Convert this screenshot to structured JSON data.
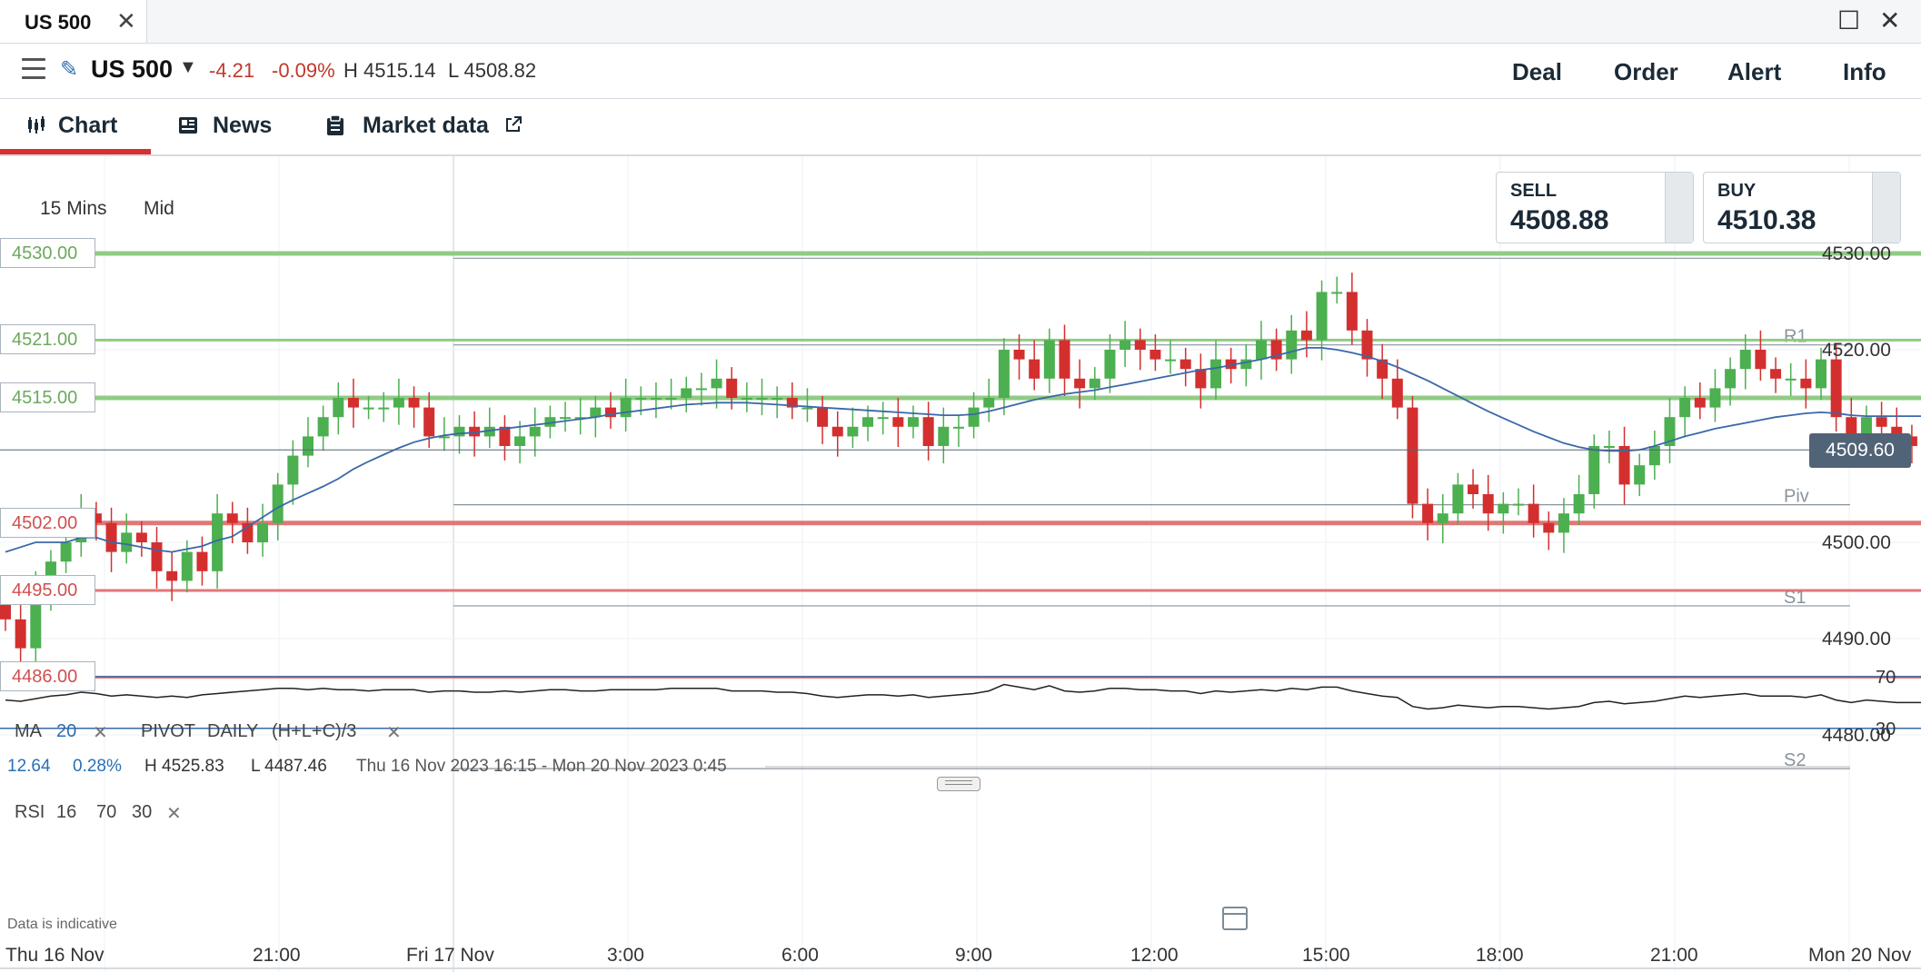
{
  "tab": {
    "title": "US 500",
    "close": "✕"
  },
  "window": {
    "maximize": "☐",
    "close": "✕"
  },
  "header": {
    "market": "US 500",
    "change": "-4.21",
    "change_pct": "-0.09%",
    "high": "H 4515.14",
    "low": "L 4508.82",
    "buttons": [
      "Deal",
      "Order",
      "Alert",
      "Info"
    ]
  },
  "subtabs": [
    {
      "label": "Chart",
      "active": true,
      "icon": "candlestick-icon"
    },
    {
      "label": "News",
      "active": false,
      "icon": "newspaper-icon"
    },
    {
      "label": "Market data",
      "active": false,
      "icon": "clipboard-icon"
    }
  ],
  "toolbar": {
    "timeframe": "15 Mins",
    "price_type": "Mid"
  },
  "quote": {
    "sell_label": "SELL",
    "sell": "4508.88",
    "buy_label": "BUY",
    "buy": "4510.38"
  },
  "indicators": {
    "ma_label": "MA",
    "ma_period": "20",
    "pivot_label": "PIVOT",
    "pivot_period": "DAILY",
    "pivot_formula": "(H+L+C)/3",
    "remove": "✕"
  },
  "stats": {
    "change": "12.64",
    "change_pct": "0.28%",
    "high": "H 4525.83",
    "low": "L 4487.46",
    "range": "Thu 16 Nov 2023 16:15 - Mon 20 Nov 2023 0:45"
  },
  "rsi": {
    "label": "RSI",
    "period": "16",
    "upper": "70",
    "lower": "30",
    "remove": "✕"
  },
  "disclaimer": "Data is indicative",
  "colors": {
    "up": "#4caf50",
    "down": "#d32f2f",
    "ma": "#3a68a8",
    "support": "#e07070",
    "resistance": "#8cc97f"
  },
  "chart_data": {
    "type": "candlestick",
    "y_axis": {
      "ticks": [
        4530,
        4520,
        4500,
        4490,
        4480
      ],
      "range": [
        4476,
        4535
      ]
    },
    "x_axis": {
      "ticks": [
        "Thu 16 Nov",
        "21:00",
        "Fri 17 Nov",
        "3:00",
        "6:00",
        "9:00",
        "12:00",
        "15:00",
        "18:00",
        "21:00",
        "Mon 20 Nov"
      ]
    },
    "current_price": "4509.60",
    "levels": [
      {
        "label": "4530.00",
        "value": 4530,
        "kind": "resistance"
      },
      {
        "label": "4521.00",
        "value": 4521,
        "kind": "resistance"
      },
      {
        "label": "4515.00",
        "value": 4515,
        "kind": "resistance"
      },
      {
        "label": "4502.00",
        "value": 4502,
        "kind": "support"
      },
      {
        "label": "4495.00",
        "value": 4495,
        "kind": "support"
      },
      {
        "label": "4486.00",
        "value": 4486,
        "kind": "support"
      }
    ],
    "pivots": [
      {
        "label": "",
        "value": 4529.5
      },
      {
        "label": "R1",
        "value": 4520.5
      },
      {
        "label": "Piv",
        "value": 4503.9
      },
      {
        "label": "S1",
        "value": 4493.4
      },
      {
        "label": "S2",
        "value": 4476.5
      }
    ],
    "close": [
      4492,
      4489,
      4495,
      4498,
      4500,
      4503,
      4502,
      4499,
      4501,
      4500,
      4497,
      4496,
      4499,
      4497,
      4503,
      4502,
      4500,
      4502,
      4506,
      4509,
      4511,
      4513,
      4515,
      4514,
      4514,
      4514,
      4515,
      4514,
      4511,
      4511,
      4512,
      4511,
      4512,
      4510,
      4511,
      4512,
      4513,
      4513,
      4513,
      4514,
      4513,
      4515,
      4515,
      4515,
      4515,
      4516,
      4516,
      4517,
      4515,
      4515,
      4515,
      4515,
      4514,
      4514,
      4512,
      4511,
      4512,
      4513,
      4513,
      4512,
      4513,
      4510,
      4512,
      4512,
      4514,
      4515,
      4520,
      4519,
      4517,
      4521,
      4517,
      4516,
      4517,
      4520,
      4521,
      4520,
      4519,
      4519,
      4518,
      4516,
      4519,
      4518,
      4519,
      4521,
      4519,
      4522,
      4521,
      4526,
      4526,
      4522,
      4519,
      4517,
      4514,
      4504,
      4502,
      4503,
      4506,
      4505,
      4503,
      4504,
      4504,
      4502,
      4501,
      4503,
      4505,
      4510,
      4510,
      4506,
      4508,
      4510,
      4513,
      4515,
      4514,
      4516,
      4518,
      4520,
      4518,
      4517,
      4517,
      4516,
      4519,
      4513,
      4511,
      4513,
      4512,
      4511,
      4510,
      4510
    ],
    "ma": [
      4499,
      4499.5,
      4500,
      4500,
      4500,
      4500.5,
      4500.5,
      4500,
      4499.8,
      4499.5,
      4499.2,
      4499,
      4499.3,
      4499.6,
      4500.2,
      4500.6,
      4501.6,
      4502.6,
      4503.6,
      4504.4,
      4505.1,
      4505.8,
      4506.6,
      4507.6,
      4508.4,
      4509.1,
      4509.8,
      4510.4,
      4510.8,
      4511.1,
      4511.3,
      4511.4,
      4511.6,
      4511.8,
      4512,
      4512.2,
      4512.4,
      4512.6,
      4512.8,
      4513,
      4513.3,
      4513.5,
      4513.7,
      4513.9,
      4514.1,
      4514.3,
      4514.4,
      4514.5,
      4514.5,
      4514.5,
      4514.4,
      4514.3,
      4514.2,
      4514.1,
      4514,
      4513.9,
      4513.8,
      4513.7,
      4513.6,
      4513.5,
      4513.4,
      4513.3,
      4513.2,
      4513.2,
      4513.3,
      4513.6,
      4514,
      4514.4,
      4514.8,
      4515.1,
      4515.4,
      4515.6,
      4515.8,
      4516.1,
      4516.4,
      4516.7,
      4517,
      4517.3,
      4517.6,
      4517.9,
      4518.1,
      4518.4,
      4518.7,
      4519,
      4519.4,
      4519.8,
      4520.2,
      4520.2,
      4520,
      4519.7,
      4519.3,
      4518.8,
      4518.2,
      4517.5,
      4516.8,
      4516,
      4515.2,
      4514.4,
      4513.6,
      4512.9,
      4512.2,
      4511.5,
      4510.9,
      4510.3,
      4509.9,
      4509.6,
      4509.5,
      4509.5,
      4509.6,
      4510,
      4510.5,
      4511,
      4511.4,
      4511.8,
      4512.1,
      4512.4,
      4512.7,
      4513,
      4513.2,
      4513.4,
      4513.5,
      4513.4,
      4513.2,
      4513.1,
      4513.1,
      4513.1,
      4513.1,
      4513.1
    ],
    "rsi": [
      52,
      51,
      53,
      55,
      56,
      58,
      57,
      55,
      56,
      55,
      54,
      55,
      54,
      56,
      57,
      58,
      59,
      60,
      61,
      61,
      60,
      61,
      60,
      60,
      59,
      60,
      60,
      60,
      58,
      59,
      59,
      58,
      58,
      59,
      58,
      59,
      60,
      60,
      59,
      59,
      60,
      60,
      60,
      60,
      61,
      61,
      61,
      61,
      59,
      59,
      59,
      58,
      58,
      57,
      55,
      54,
      55,
      56,
      56,
      55,
      56,
      54,
      55,
      56,
      57,
      59,
      64,
      62,
      60,
      63,
      59,
      58,
      59,
      61,
      61,
      60,
      60,
      59,
      59,
      57,
      59,
      58,
      59,
      60,
      59,
      61,
      60,
      62,
      62,
      59,
      57,
      55,
      54,
      47,
      45,
      46,
      48,
      47,
      46,
      47,
      47,
      46,
      45,
      46,
      47,
      50,
      51,
      49,
      50,
      51,
      53,
      55,
      54,
      55,
      56,
      57,
      55,
      55,
      55,
      54,
      56,
      52,
      50,
      52,
      51,
      50,
      50,
      50
    ]
  }
}
